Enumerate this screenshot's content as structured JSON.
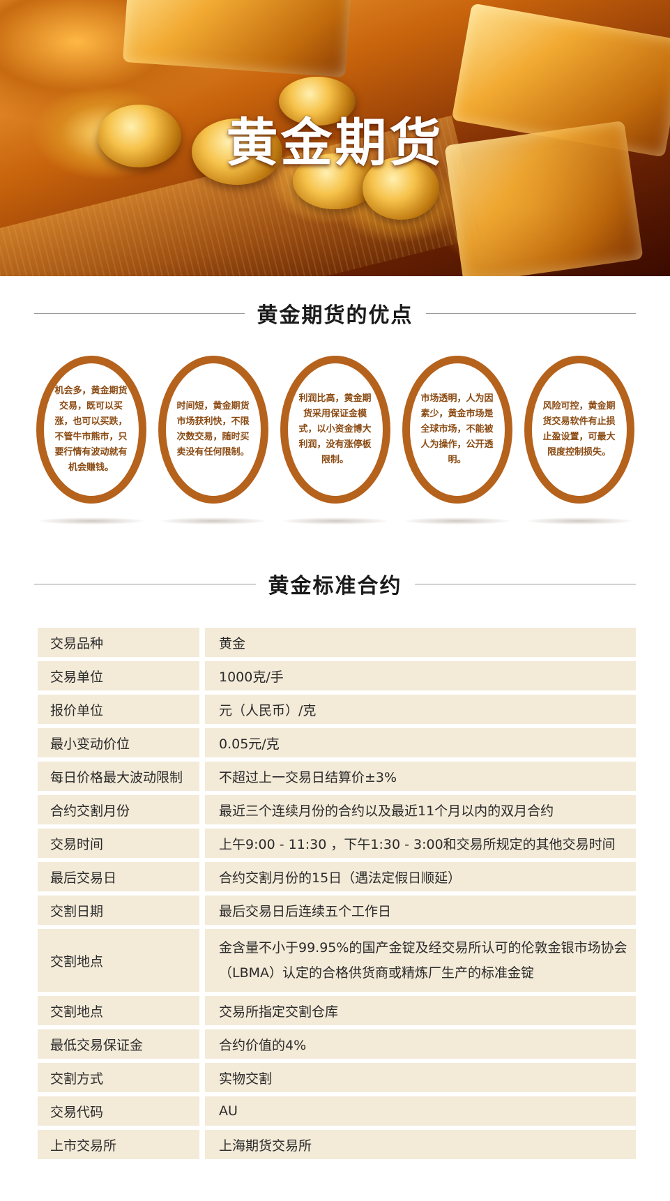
{
  "hero": {
    "title": "黄金期货"
  },
  "advantages_section": {
    "title": "黄金期货的优点",
    "items": [
      {
        "text": "机会多，黄金期货交易，既可以买涨，也可以买跌，不管牛市熊市，只要行情有波动就有机会赚钱。"
      },
      {
        "text": "时间短，黄金期货市场获利快，不限次数交易，随时买卖没有任何限制。"
      },
      {
        "text": "利润比高，黄金期货采用保证金模式，以小资金博大利润，没有涨停板限制。"
      },
      {
        "text": "市场透明，人为因素少，黄金市场是全球市场，不能被人为操作，公开透明。"
      },
      {
        "text": "风险可控，黄金期货交易软件有止损止盈设置，可最大限度控制损失。"
      }
    ]
  },
  "contract_section": {
    "title": "黄金标准合约",
    "rows": [
      {
        "key": "交易品种",
        "value": "黄金"
      },
      {
        "key": "交易单位",
        "value": "1000克/手"
      },
      {
        "key": "报价单位",
        "value": "元（人民币）/克"
      },
      {
        "key": "最小变动价位",
        "value": "0.05元/克"
      },
      {
        "key": "每日价格最大波动限制",
        "value": "不超过上一交易日结算价±3%"
      },
      {
        "key": "合约交割月份",
        "value": "最近三个连续月份的合约以及最近11个月以内的双月合约"
      },
      {
        "key": "交易时间",
        "value": "上午9:00 - 11:30 ，下午1:30 - 3:00和交易所规定的其他交易时间"
      },
      {
        "key": "最后交易日",
        "value": "合约交割月份的15日（遇法定假日顺延）"
      },
      {
        "key": "交割日期",
        "value": "最后交易日后连续五个工作日"
      },
      {
        "key": "交割地点",
        "value": "金含量不小于99.95%的国产金锭及经交易所认可的伦敦金银市场协会（LBMA）认定的合格供货商或精炼厂生产的标准金锭"
      },
      {
        "key": "交割地点",
        "value": "交易所指定交割仓库"
      },
      {
        "key": "最低交易保证金",
        "value": "合约价值的4%"
      },
      {
        "key": "交割方式",
        "value": "实物交割"
      },
      {
        "key": "交易代码",
        "value": "AU"
      },
      {
        "key": "上市交易所",
        "value": "上海期货交易所"
      }
    ]
  },
  "colors": {
    "oval_border": "#b5621d",
    "oval_text": "#8a4a12",
    "table_cell_bg": "#f3ead8"
  }
}
